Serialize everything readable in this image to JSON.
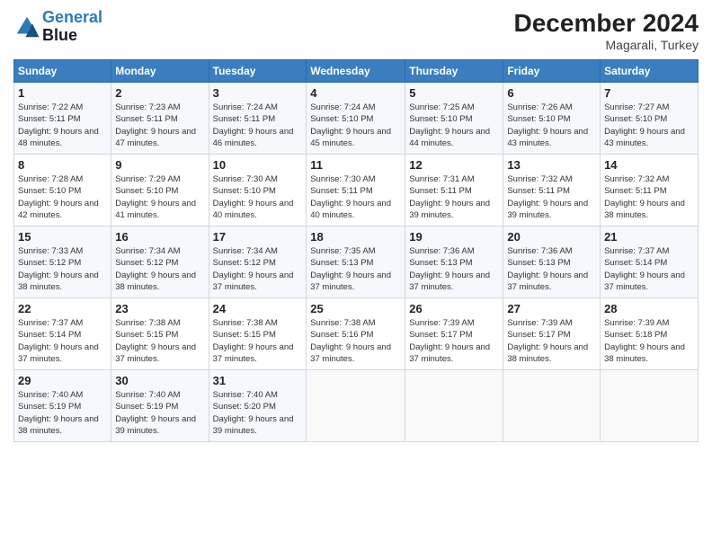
{
  "logo": {
    "line1": "General",
    "line2": "Blue"
  },
  "title": "December 2024",
  "location": "Magarali, Turkey",
  "days_of_week": [
    "Sunday",
    "Monday",
    "Tuesday",
    "Wednesday",
    "Thursday",
    "Friday",
    "Saturday"
  ],
  "weeks": [
    [
      {
        "day": "1",
        "sunrise": "7:22 AM",
        "sunset": "5:11 PM",
        "daylight": "9 hours and 48 minutes."
      },
      {
        "day": "2",
        "sunrise": "7:23 AM",
        "sunset": "5:11 PM",
        "daylight": "9 hours and 47 minutes."
      },
      {
        "day": "3",
        "sunrise": "7:24 AM",
        "sunset": "5:11 PM",
        "daylight": "9 hours and 46 minutes."
      },
      {
        "day": "4",
        "sunrise": "7:24 AM",
        "sunset": "5:10 PM",
        "daylight": "9 hours and 45 minutes."
      },
      {
        "day": "5",
        "sunrise": "7:25 AM",
        "sunset": "5:10 PM",
        "daylight": "9 hours and 44 minutes."
      },
      {
        "day": "6",
        "sunrise": "7:26 AM",
        "sunset": "5:10 PM",
        "daylight": "9 hours and 43 minutes."
      },
      {
        "day": "7",
        "sunrise": "7:27 AM",
        "sunset": "5:10 PM",
        "daylight": "9 hours and 43 minutes."
      }
    ],
    [
      {
        "day": "8",
        "sunrise": "7:28 AM",
        "sunset": "5:10 PM",
        "daylight": "9 hours and 42 minutes."
      },
      {
        "day": "9",
        "sunrise": "7:29 AM",
        "sunset": "5:10 PM",
        "daylight": "9 hours and 41 minutes."
      },
      {
        "day": "10",
        "sunrise": "7:30 AM",
        "sunset": "5:10 PM",
        "daylight": "9 hours and 40 minutes."
      },
      {
        "day": "11",
        "sunrise": "7:30 AM",
        "sunset": "5:11 PM",
        "daylight": "9 hours and 40 minutes."
      },
      {
        "day": "12",
        "sunrise": "7:31 AM",
        "sunset": "5:11 PM",
        "daylight": "9 hours and 39 minutes."
      },
      {
        "day": "13",
        "sunrise": "7:32 AM",
        "sunset": "5:11 PM",
        "daylight": "9 hours and 39 minutes."
      },
      {
        "day": "14",
        "sunrise": "7:32 AM",
        "sunset": "5:11 PM",
        "daylight": "9 hours and 38 minutes."
      }
    ],
    [
      {
        "day": "15",
        "sunrise": "7:33 AM",
        "sunset": "5:12 PM",
        "daylight": "9 hours and 38 minutes."
      },
      {
        "day": "16",
        "sunrise": "7:34 AM",
        "sunset": "5:12 PM",
        "daylight": "9 hours and 38 minutes."
      },
      {
        "day": "17",
        "sunrise": "7:34 AM",
        "sunset": "5:12 PM",
        "daylight": "9 hours and 37 minutes."
      },
      {
        "day": "18",
        "sunrise": "7:35 AM",
        "sunset": "5:13 PM",
        "daylight": "9 hours and 37 minutes."
      },
      {
        "day": "19",
        "sunrise": "7:36 AM",
        "sunset": "5:13 PM",
        "daylight": "9 hours and 37 minutes."
      },
      {
        "day": "20",
        "sunrise": "7:36 AM",
        "sunset": "5:13 PM",
        "daylight": "9 hours and 37 minutes."
      },
      {
        "day": "21",
        "sunrise": "7:37 AM",
        "sunset": "5:14 PM",
        "daylight": "9 hours and 37 minutes."
      }
    ],
    [
      {
        "day": "22",
        "sunrise": "7:37 AM",
        "sunset": "5:14 PM",
        "daylight": "9 hours and 37 minutes."
      },
      {
        "day": "23",
        "sunrise": "7:38 AM",
        "sunset": "5:15 PM",
        "daylight": "9 hours and 37 minutes."
      },
      {
        "day": "24",
        "sunrise": "7:38 AM",
        "sunset": "5:15 PM",
        "daylight": "9 hours and 37 minutes."
      },
      {
        "day": "25",
        "sunrise": "7:38 AM",
        "sunset": "5:16 PM",
        "daylight": "9 hours and 37 minutes."
      },
      {
        "day": "26",
        "sunrise": "7:39 AM",
        "sunset": "5:17 PM",
        "daylight": "9 hours and 37 minutes."
      },
      {
        "day": "27",
        "sunrise": "7:39 AM",
        "sunset": "5:17 PM",
        "daylight": "9 hours and 38 minutes."
      },
      {
        "day": "28",
        "sunrise": "7:39 AM",
        "sunset": "5:18 PM",
        "daylight": "9 hours and 38 minutes."
      }
    ],
    [
      {
        "day": "29",
        "sunrise": "7:40 AM",
        "sunset": "5:19 PM",
        "daylight": "9 hours and 38 minutes."
      },
      {
        "day": "30",
        "sunrise": "7:40 AM",
        "sunset": "5:19 PM",
        "daylight": "9 hours and 39 minutes."
      },
      {
        "day": "31",
        "sunrise": "7:40 AM",
        "sunset": "5:20 PM",
        "daylight": "9 hours and 39 minutes."
      },
      null,
      null,
      null,
      null
    ]
  ]
}
